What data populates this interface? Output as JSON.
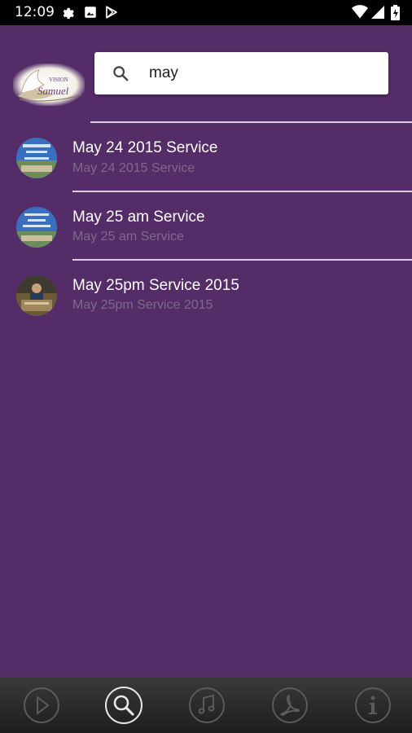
{
  "status_bar": {
    "time": "12:09",
    "left_icons": [
      "gear-icon",
      "photo-icon",
      "play-store-icon"
    ],
    "right_icons": [
      "wifi-icon",
      "signal-icon",
      "battery-icon"
    ]
  },
  "header": {
    "logo": "church-dove-logo",
    "search": {
      "value": "may",
      "placeholder": ""
    }
  },
  "results": [
    {
      "title": "May 24 2015 Service",
      "subtitle": "May 24 2015 Service",
      "thumb": "blue"
    },
    {
      "title": "May 25 am Service",
      "subtitle": "May 25 am Service",
      "thumb": "blue"
    },
    {
      "title": "May 25pm Service 2015",
      "subtitle": "May 25pm Service 2015",
      "thumb": "brown"
    }
  ],
  "bottom_nav": {
    "items": [
      {
        "name": "play-icon",
        "active": false
      },
      {
        "name": "search-icon",
        "active": true
      },
      {
        "name": "music-icon",
        "active": false
      },
      {
        "name": "pdf-icon",
        "active": false
      },
      {
        "name": "info-icon",
        "active": false
      }
    ]
  },
  "colors": {
    "background": "#532c68",
    "divider": "#d9cce3",
    "title": "#ffffff",
    "subtitle": "#7d6a8a",
    "nav_inactive": "#5b5b5b",
    "nav_active": "#e6e6e6"
  }
}
